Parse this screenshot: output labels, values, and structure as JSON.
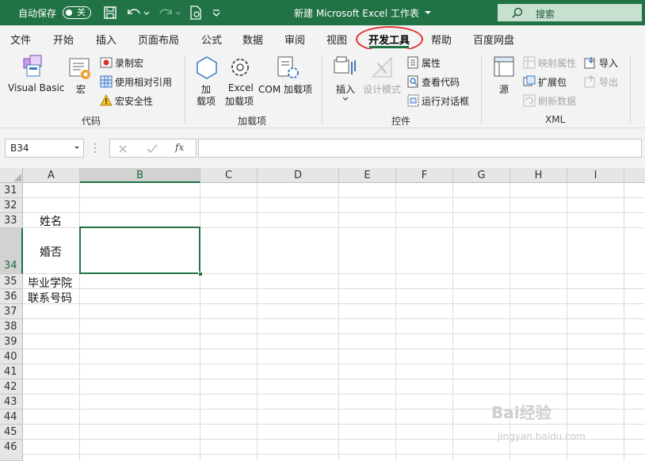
{
  "titlebar": {
    "autosave_label": "自动保存",
    "autosave_state": "关",
    "title": "新建 Microsoft Excel 工作表",
    "search_placeholder": "搜索"
  },
  "tabs": [
    {
      "label": "文件"
    },
    {
      "label": "开始"
    },
    {
      "label": "插入"
    },
    {
      "label": "页面布局"
    },
    {
      "label": "公式"
    },
    {
      "label": "数据"
    },
    {
      "label": "审阅"
    },
    {
      "label": "视图"
    },
    {
      "label": "开发工具",
      "active": true
    },
    {
      "label": "帮助"
    },
    {
      "label": "百度网盘"
    }
  ],
  "ribbon": {
    "code": {
      "group_name": "代码",
      "visual_basic": "Visual Basic",
      "macros": "宏",
      "record_macro": "录制宏",
      "relative_ref": "使用相对引用",
      "macro_security": "宏安全性"
    },
    "addins": {
      "group_name": "加载项",
      "addins_line1": "加",
      "addins_line2": "载项",
      "excel_addins_line1": "Excel",
      "excel_addins_line2": "加载项",
      "com_addins": "COM 加载项"
    },
    "controls": {
      "group_name": "控件",
      "insert": "插入",
      "design_mode": "设计模式",
      "properties": "属性",
      "view_code": "查看代码",
      "run_dialog": "运行对话框"
    },
    "xml": {
      "group_name": "XML",
      "source": "源",
      "map_properties": "映射属性",
      "expansion_packs": "扩展包",
      "refresh_data": "刷新数据",
      "import": "导入",
      "export": "导出"
    }
  },
  "formula_bar": {
    "name_box": "B34",
    "fx_label": "fx",
    "formula": ""
  },
  "columns": [
    "A",
    "B",
    "C",
    "D",
    "E",
    "F",
    "G",
    "H",
    "I"
  ],
  "rows": [
    "31",
    "32",
    "33",
    "34",
    "35",
    "36",
    "37",
    "38",
    "39",
    "40",
    "41",
    "42",
    "43",
    "44",
    "45",
    "46"
  ],
  "cells": {
    "A33": "姓名",
    "A34": "婚否",
    "A35": "毕业学院",
    "A36": "联系号码"
  },
  "watermark": {
    "brand": "Bai经验",
    "url": "jingyan.baidu.com"
  },
  "colors": {
    "accent": "#217346",
    "highlight_ring": "#e0332c"
  }
}
